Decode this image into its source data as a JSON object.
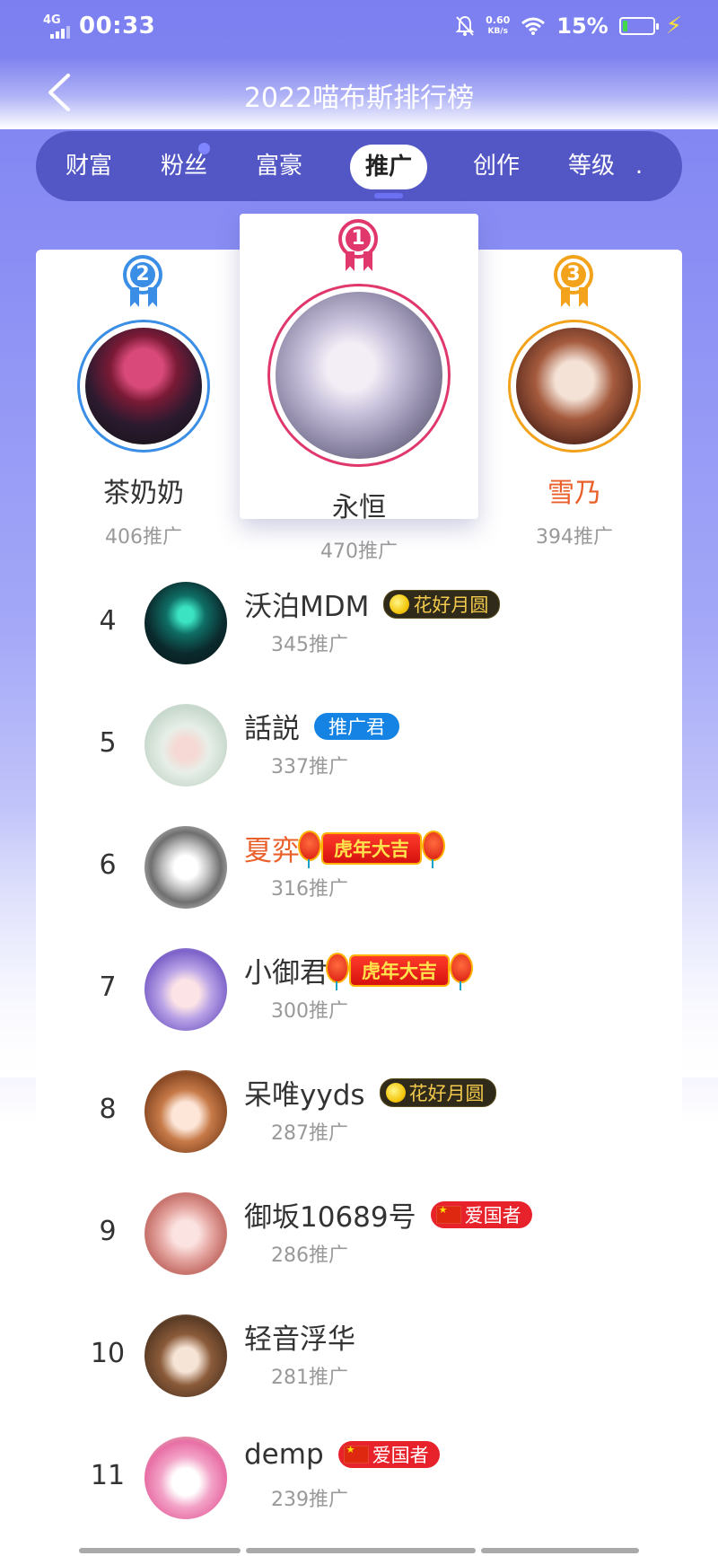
{
  "status_bar": {
    "network": "4G",
    "time": "00:33",
    "speed_value": "0.60",
    "speed_unit": "KB/s",
    "battery": "15%",
    "battery_level": 0.15
  },
  "header": {
    "title": "2022喵布斯排行榜"
  },
  "tabs": [
    {
      "label": "财富"
    },
    {
      "label": "粉丝"
    },
    {
      "label": "富豪"
    },
    {
      "label": "推广"
    },
    {
      "label": "创作"
    },
    {
      "label": "等级"
    },
    {
      "label": "."
    }
  ],
  "podium": [
    {
      "rank": "1",
      "name": "永恒",
      "score": "470推广",
      "color": "#e0386c"
    },
    {
      "rank": "2",
      "name": "茶奶奶",
      "score": "406推广",
      "color": "#3a8ee6"
    },
    {
      "rank": "3",
      "name": "雪乃",
      "score": "394推广",
      "color": "#f3a21c"
    }
  ],
  "list": [
    {
      "rank": "4",
      "name": "沃泊MDM",
      "score": "345推广",
      "badge": "花好月圆"
    },
    {
      "rank": "5",
      "name": "話説",
      "score": "337推广",
      "badge": "推广君"
    },
    {
      "rank": "6",
      "name": "夏弈",
      "score": "316推广",
      "badge": "虎年大吉"
    },
    {
      "rank": "7",
      "name": "小御君",
      "score": "300推广",
      "badge": "虎年大吉"
    },
    {
      "rank": "8",
      "name": "呆唯yyds",
      "score": "287推广",
      "badge": "花好月圆"
    },
    {
      "rank": "9",
      "name": "御坂10689号",
      "score": "286推广",
      "badge": "爱国者"
    },
    {
      "rank": "10",
      "name": "轻音浮华",
      "score": "281推广",
      "badge": ""
    },
    {
      "rank": "11",
      "name": "demp",
      "score": "239推广",
      "badge": "爱国者"
    }
  ],
  "colors": {
    "accent": "#5357c6",
    "gold_badge": "#f2c94c",
    "blue_badge": "#1483e3",
    "red_badge": "#e8222a",
    "name_highlight": "#e9602b"
  },
  "icons": {
    "back": "chevron-left-icon",
    "mute": "bell-off-icon",
    "wifi": "wifi-icon",
    "charging": "lightning-icon"
  }
}
